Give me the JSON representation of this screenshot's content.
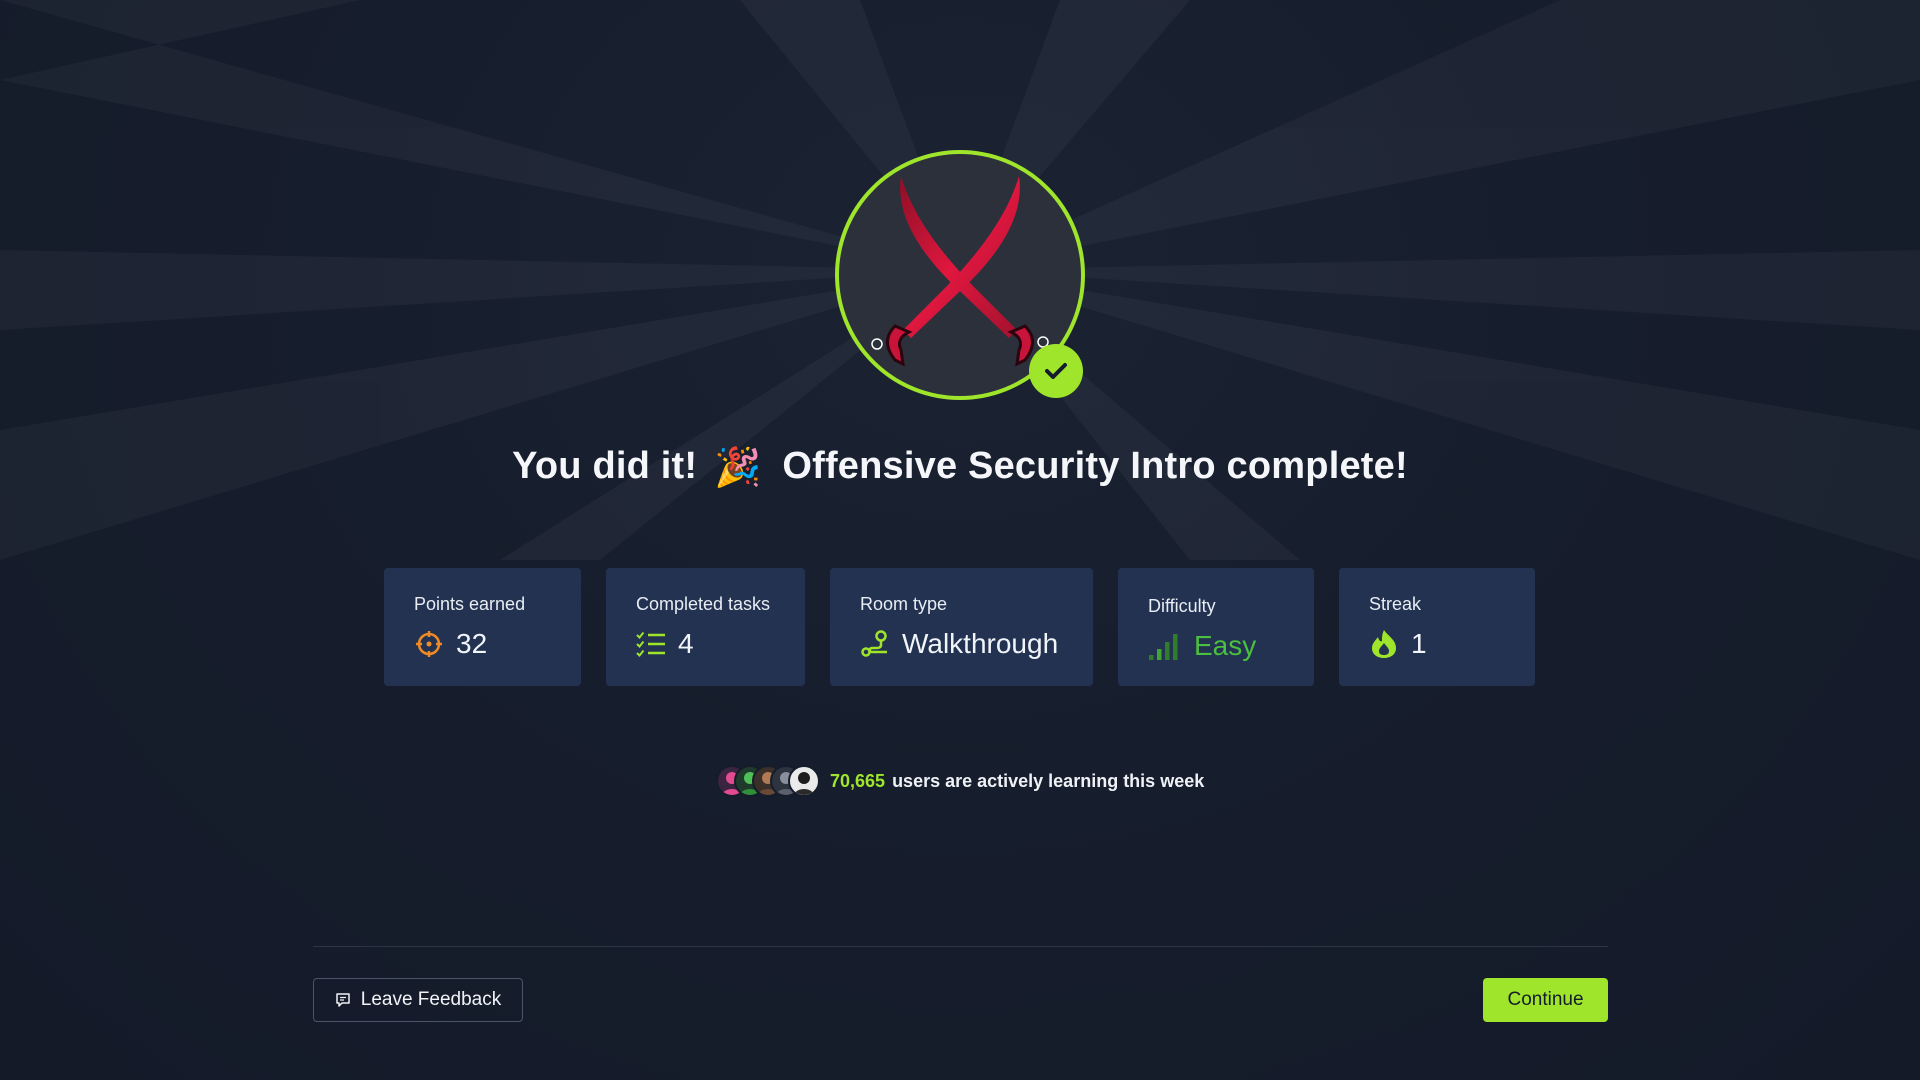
{
  "headline": {
    "prefix": "You did it!",
    "emoji": "🎉",
    "room_completed": "Offensive Security Intro complete!"
  },
  "badge": {
    "icon": "crossed-swords-icon",
    "ring_color": "#9fe52b",
    "status": "completed"
  },
  "stats": [
    {
      "label": "Points earned",
      "value": "32",
      "icon": "crosshair-icon",
      "icon_color": "#f08a24"
    },
    {
      "label": "Completed tasks",
      "value": "4",
      "icon": "checklist-icon",
      "icon_color": "#9fe52b"
    },
    {
      "label": "Room type",
      "value": "Walkthrough",
      "icon": "route-icon",
      "icon_color": "#9fe52b"
    },
    {
      "label": "Difficulty",
      "value": "Easy",
      "icon": "signal-bars-icon",
      "icon_color": "#4bbf3f"
    },
    {
      "label": "Streak",
      "value": "1",
      "icon": "flame-icon",
      "icon_color": "#9fe52b"
    }
  ],
  "learners": {
    "count": "70,665",
    "text": "users are actively learning this week"
  },
  "footer": {
    "feedback_label": "Leave Feedback",
    "continue_label": "Continue"
  },
  "colors": {
    "background": "#151c2b",
    "card": "#223250",
    "accent": "#9fe52b"
  }
}
